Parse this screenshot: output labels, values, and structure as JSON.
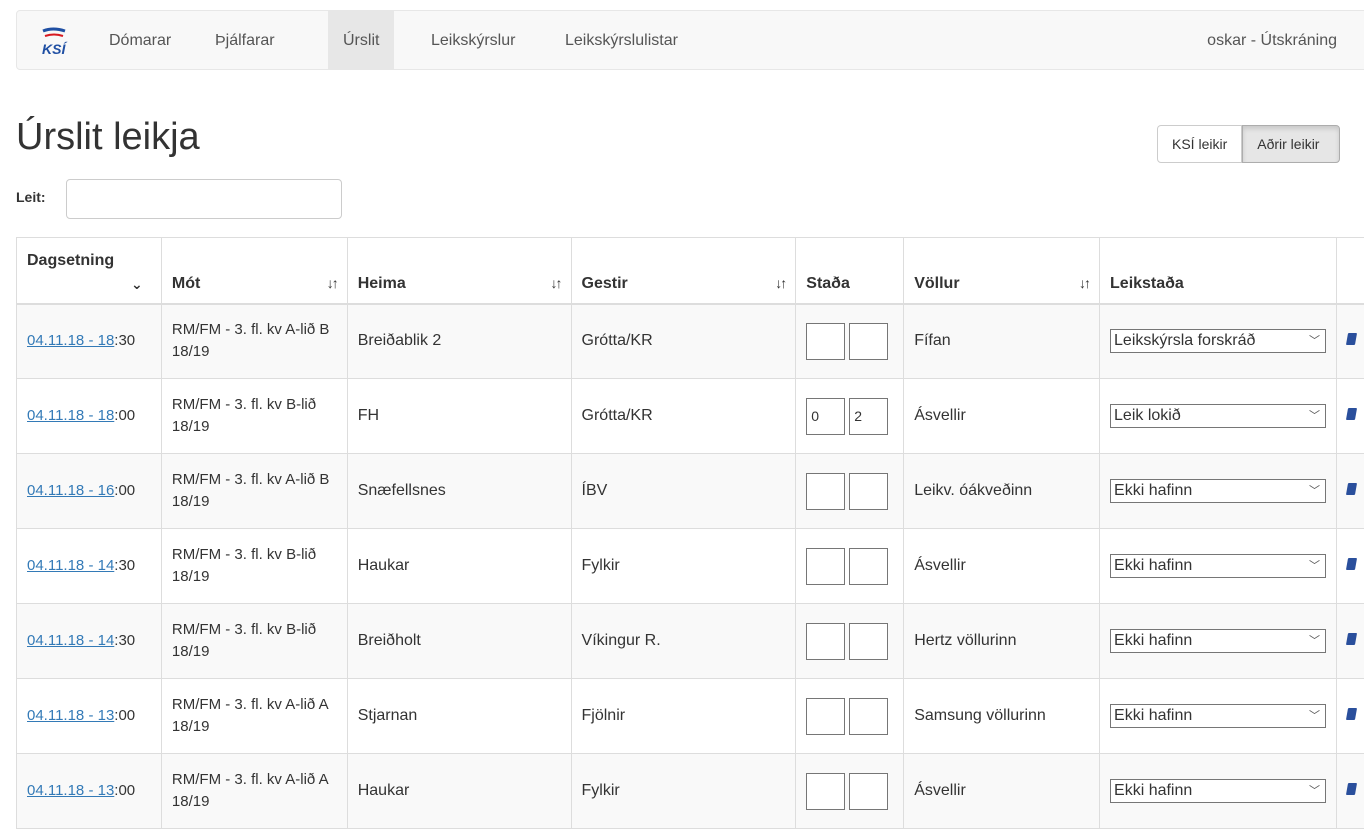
{
  "nav": {
    "items": [
      {
        "label": "Dómarar",
        "active": false
      },
      {
        "label": "Þjálfarar",
        "active": false
      },
      {
        "label": "Úrslit",
        "active": true
      },
      {
        "label": "Leikskýrslur",
        "active": false
      },
      {
        "label": "Leikskýrslulistar",
        "active": false
      }
    ],
    "user_link": "oskar - Útskráning",
    "logo_icon": "ksi-logo"
  },
  "page_title": "Úrslit leikja",
  "toggle": {
    "ksi_label": "KSÍ leikir",
    "other_label": "Aðrir leikir",
    "selected": "Aðrir leikir"
  },
  "search": {
    "label": "Leit:",
    "value": ""
  },
  "table": {
    "headers": {
      "date": "Dagsetning",
      "tournament": "Mót",
      "home": "Heima",
      "away": "Gestir",
      "score": "Staða",
      "venue": "Völlur",
      "status": "Leikstaða"
    },
    "rows": [
      {
        "date_link": "04.11.18 - 18",
        "time_rest": ":30",
        "tournament": "RM/FM - 3. fl. kv A-lið B 18/19",
        "home": "Breiðablik 2",
        "away": "Grótta/KR",
        "home_score": "",
        "away_score": "",
        "venue": "Fífan",
        "status": "Leikskýrsla forskráð"
      },
      {
        "date_link": "04.11.18 - 18",
        "time_rest": ":00",
        "tournament": "RM/FM - 3. fl. kv B-lið 18/19",
        "home": "FH",
        "away": "Grótta/KR",
        "home_score": "0",
        "away_score": "2",
        "venue": "Ásvellir",
        "status": "Leik lokið"
      },
      {
        "date_link": "04.11.18 - 16",
        "time_rest": ":00",
        "tournament": "RM/FM - 3. fl. kv A-lið B 18/19",
        "home": "Snæfellsnes",
        "away": "ÍBV",
        "home_score": "",
        "away_score": "",
        "venue": "Leikv. óákveðinn",
        "status": "Ekki hafinn"
      },
      {
        "date_link": "04.11.18 - 14",
        "time_rest": ":30",
        "tournament": "RM/FM - 3. fl. kv B-lið 18/19",
        "home": "Haukar",
        "away": "Fylkir",
        "home_score": "",
        "away_score": "",
        "venue": "Ásvellir",
        "status": "Ekki hafinn"
      },
      {
        "date_link": "04.11.18 - 14",
        "time_rest": ":30",
        "tournament": "RM/FM - 3. fl. kv B-lið 18/19",
        "home": "Breiðholt",
        "away": "Víkingur R.",
        "home_score": "",
        "away_score": "",
        "venue": "Hertz völlurinn",
        "status": "Ekki hafinn"
      },
      {
        "date_link": "04.11.18 - 13",
        "time_rest": ":00",
        "tournament": "RM/FM - 3. fl. kv A-lið A 18/19",
        "home": "Stjarnan",
        "away": "Fjölnir",
        "home_score": "",
        "away_score": "",
        "venue": "Samsung völlurinn",
        "status": "Ekki hafinn"
      },
      {
        "date_link": "04.11.18 - 13",
        "time_rest": ":00",
        "tournament": "RM/FM - 3. fl. kv A-lið A 18/19",
        "home": "Haukar",
        "away": "Fylkir",
        "home_score": "",
        "away_score": "",
        "venue": "Ásvellir",
        "status": "Ekki hafinn"
      }
    ]
  }
}
